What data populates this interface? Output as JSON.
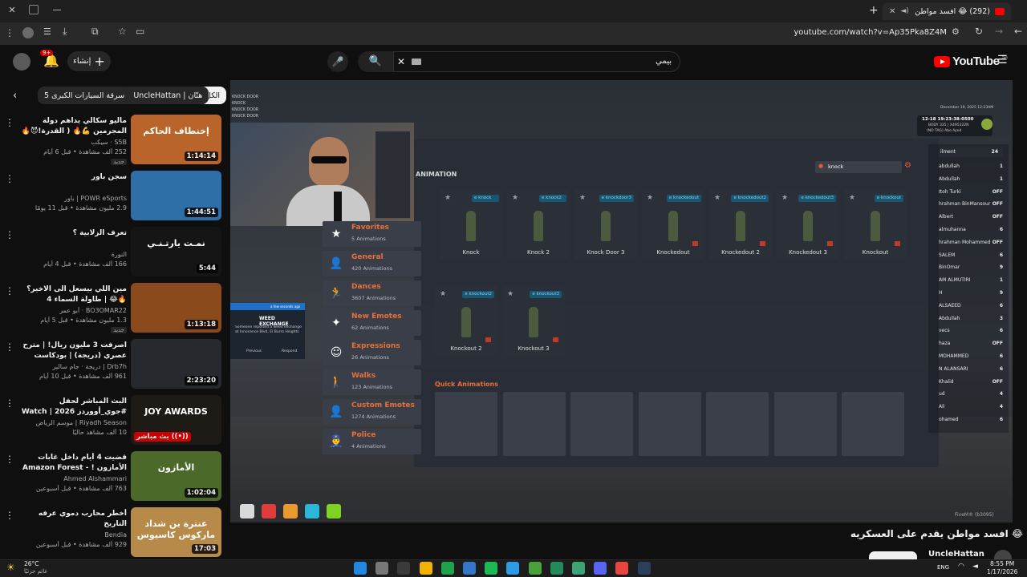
{
  "browser": {
    "tab_title": "(292) 😂 افسد مواطن يقدم",
    "url": "youtube.com/watch?v=Ap35Pka8Z4M"
  },
  "youtube": {
    "logo": "YouTube",
    "logo_region": "SA",
    "search_value": "بيمي",
    "create_label": "إنشاء",
    "notif_count": "9+",
    "chips": [
      "الكل",
      "من UncleHattan | هتّان",
      "سرقة السيارات الكبرى 5"
    ]
  },
  "videos": [
    {
      "title": "ماليو سكالي يداهم دولة المجرمين 💪🔥 ( القدرة!😈🔥 ) رسيكت الحياة الواقعية",
      "channel": "S5B · سيكب",
      "meta": "252 ألف مشاهدة • قبل 6 أيام",
      "badge": "جديد",
      "duration": "1:14:14",
      "thumb_text": "إختطاف الحاكم",
      "thumb_bg": "#b8642a"
    },
    {
      "title": "سجن باور",
      "channel": "POWR eSports | باور",
      "meta": "2.9 مليون مشاهدة • قبل 11 يومًا",
      "badge": "",
      "duration": "1:44:51",
      "thumb_text": "",
      "thumb_bg": "#2f6fa8"
    },
    {
      "title": "تعرف الزلابية ؟",
      "channel": "النورة",
      "meta": "166 ألف مشاهدة • قبل 4 أيام",
      "badge": "",
      "duration": "5:44",
      "thumb_text": "نمـت يارتـنـي",
      "thumb_bg": "#151515"
    },
    {
      "title": "مين اللي بيسعل الى الاخير؟ 🔥😂 | طاولة السماء 4",
      "channel": "BO3OMAR22 · أبو عمر",
      "meta": "1.3 مليون مشاهدة • قبل 5 أيام",
      "badge": "جديد",
      "duration": "1:13:18",
      "thumb_text": "",
      "thumb_bg": "#8a4a1c"
    },
    {
      "title": "اصرفت 3 مليون ريال! | مترح عصري (دريجة) | بودكاست بسوير خير",
      "channel": "Drb7h | دريجة · جام سالير",
      "meta": "961 ألف مشاهدة • قبل 10 أيام",
      "badge": "",
      "duration": "2:23:20",
      "thumb_text": "",
      "thumb_bg": "#26292d"
    },
    {
      "title": "البث المباشر لحفل #جوي_أووردز 2026 | Watch the Live Stream of Joy...",
      "channel": "Riyadh Season | موسم الرياض",
      "meta": "10 آلف مشاهد حاليًا",
      "badge": "",
      "duration": "",
      "live": "بث مباشر ((•))",
      "thumb_text": "JOY AWARDS",
      "thumb_bg": "#1e1b16"
    },
    {
      "title": "قضيت 4 أيام داخل غابات الأمازون ! - Amazon Forest",
      "channel": "Ahmed Alshammari",
      "meta": "763 ألف مشاهدة • قبل أسبوعين",
      "badge": "",
      "duration": "1:02:04",
      "thumb_text": "الأمازون",
      "thumb_bg": "#4b6a2a"
    },
    {
      "title": "أخطر محارب دموي عرفه التاريخ",
      "channel": "Bendia",
      "meta": "929 ألف مشاهدة • قبل أسبوعين",
      "badge": "",
      "duration": "17:03",
      "thumb_text": "عنترة بن شداد   ماركوس كاسيوس",
      "thumb_bg": "#b88a4a"
    }
  ],
  "game": {
    "panel_title": "ANIMATION",
    "search_value": "knock",
    "categories": [
      {
        "name": "Favorites",
        "count": "5 Animations",
        "icon": "★"
      },
      {
        "name": "General",
        "count": "420 Animations",
        "icon": "👤"
      },
      {
        "name": "Dances",
        "count": "3607 Animations",
        "icon": "🏃"
      },
      {
        "name": "New Emotes",
        "count": "62 Animations",
        "icon": "✦"
      },
      {
        "name": "Expressions",
        "count": "26 Animations",
        "icon": "☺"
      },
      {
        "name": "Walks",
        "count": "123 Animations",
        "icon": "🚶"
      },
      {
        "name": "Custom Emotes",
        "count": "1274 Animations",
        "icon": "👤"
      },
      {
        "name": "Police",
        "count": "4 Animations",
        "icon": "👮"
      }
    ],
    "animations": [
      {
        "tag": "e knock",
        "name": "Knock"
      },
      {
        "tag": "e knock2",
        "name": "Knock 2"
      },
      {
        "tag": "e knockdoor3",
        "name": "Knock Door 3"
      },
      {
        "tag": "e knockedout",
        "name": "Knockedout"
      },
      {
        "tag": "e knockedout2",
        "name": "Knockedout 2"
      },
      {
        "tag": "e knockedout3",
        "name": "Knockedout 3"
      },
      {
        "tag": "e knockout",
        "name": "Knockout"
      },
      {
        "tag": "e knockout2",
        "name": "Knockout 2"
      },
      {
        "tag": "e knockout3",
        "name": "Knockout 3"
      }
    ],
    "quick_title": "Quick Animations",
    "chat_lines": [
      "KNOCK DOOR",
      "KNOCK",
      "KNOCK DOOR",
      "KNOCK DOOR"
    ],
    "notif_title": "WEED EXCHANGE",
    "notif_text": "Someone reported a weed exchange at Innocence Blvd, El Burro Heights",
    "notif_time": "a few seconds ago",
    "notif_prev": "Previous",
    "notif_resp": "Respond",
    "hud_time": "12-18 19:23:38-0500",
    "hud_body": "BODY 335 | X495322N",
    "hud_tag": "(NO TAG) Abo Ayed",
    "hud_date": "December 19, 2025 12:23AM",
    "players_header": "ilment",
    "players_header_val": "24",
    "players": [
      {
        "n": "abdullah",
        "v": "1"
      },
      {
        "n": "Abdullah",
        "v": "1"
      },
      {
        "n": "Itoh Turki",
        "v": "OFF"
      },
      {
        "n": "hrahman BinMansour",
        "v": "OFF"
      },
      {
        "n": "Albert",
        "v": "OFF"
      },
      {
        "n": "almuhanna",
        "v": "6"
      },
      {
        "n": "hrahman Mohammed",
        "v": "OFF"
      },
      {
        "n": "SALEM",
        "v": "6"
      },
      {
        "n": "BinOmar",
        "v": "9"
      },
      {
        "n": "AM ALMUTIRI",
        "v": "1"
      },
      {
        "n": "H",
        "v": "9"
      },
      {
        "n": "ALSAEED",
        "v": "6"
      },
      {
        "n": "Abdullah",
        "v": "3"
      },
      {
        "n": "vecs",
        "v": "6"
      },
      {
        "n": "haza",
        "v": "OFF"
      },
      {
        "n": "MOHAMMED",
        "v": "6"
      },
      {
        "n": "N ALANSARI",
        "v": "6"
      },
      {
        "n": "Khalid",
        "v": "OFF"
      },
      {
        "n": "ud",
        "v": "4"
      },
      {
        "n": "Ali",
        "v": "4"
      },
      {
        "n": "ohamed",
        "v": "6"
      }
    ],
    "fivem": "FiveM® (b3095)",
    "hotbar_colors": [
      "#d9d9d9",
      "#e23b3b",
      "#e89a2c",
      "#2bb7d8",
      "#7ed321"
    ]
  },
  "below": {
    "video_title": "😂 افسد مواطن يقدم على العسكريه",
    "channel": "UncleHattan"
  },
  "taskbar": {
    "weather_temp": "26°C",
    "weather_desc": "غائم جزئيًا",
    "lang": "ENG",
    "time": "8:55 PM",
    "date": "1/17/2026"
  }
}
